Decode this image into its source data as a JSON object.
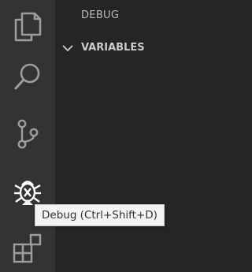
{
  "activity_bar": {
    "items": [
      {
        "icon": "files-icon"
      },
      {
        "icon": "search-icon"
      },
      {
        "icon": "source-control-icon"
      },
      {
        "icon": "debug-icon",
        "active": true
      },
      {
        "icon": "extensions-icon"
      }
    ]
  },
  "sidebar": {
    "title": "DEBUG",
    "section": {
      "label": "VARIABLES",
      "expanded": true
    }
  },
  "tooltip": {
    "text": "Debug (Ctrl+Shift+D)"
  },
  "colors": {
    "activity_bar_bg": "#333333",
    "sidebar_bg": "#252526",
    "icon_inactive": "#9d9d9d",
    "icon_active": "#ffffff",
    "tooltip_bg": "#f3f3f3"
  }
}
